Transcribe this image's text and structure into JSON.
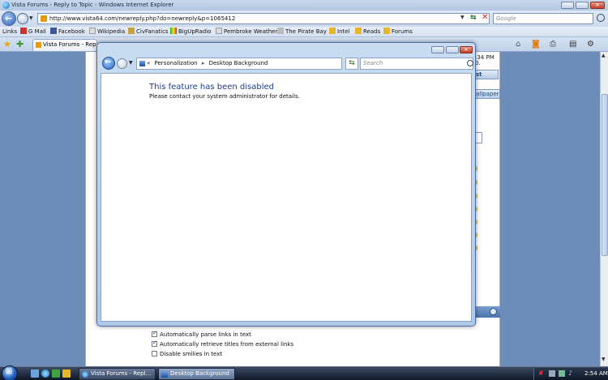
{
  "ie": {
    "title": "Vista Forums - Reply to Topic - Windows Internet Explorer",
    "url": "http://www.vista64.com/newreply.php?do=newreply&p=1065412",
    "search_placeholder": "Google",
    "links_label": "Links",
    "links": [
      "G Mail",
      "Facebook",
      "Wikipedia",
      "CivFanatics",
      "BigUpRadio",
      "Pembroke Weather",
      "The Pirate Bay",
      "Intel",
      "Reads",
      "Forums"
    ],
    "tab_label": "Vista Forums - Reply..."
  },
  "forum_background": {
    "post_time": ":34 PM",
    "post_date": "0.",
    "fragment_st": "st",
    "fragment_wallpaper": "allpaper",
    "options": [
      {
        "label": "Automatically parse links in text",
        "checked": true
      },
      {
        "label": "Automatically retrieve titles from external links",
        "checked": true
      },
      {
        "label": "Disable smilies in text",
        "checked": false
      }
    ]
  },
  "control_panel": {
    "breadcrumb": [
      "Personalization",
      "Desktop Background"
    ],
    "breadcrumb_lead": "«",
    "search_placeholder": "Search",
    "disabled_title": "This feature has been disabled",
    "disabled_message": "Please contact your system administrator for details."
  },
  "taskbar": {
    "tasks": [
      "Vista Forums - Repl...",
      "Desktop Background"
    ],
    "clock": "2:54 AM"
  },
  "colors": {
    "link_blue": "#1e3f8f",
    "desktop": "#6b8fba"
  }
}
